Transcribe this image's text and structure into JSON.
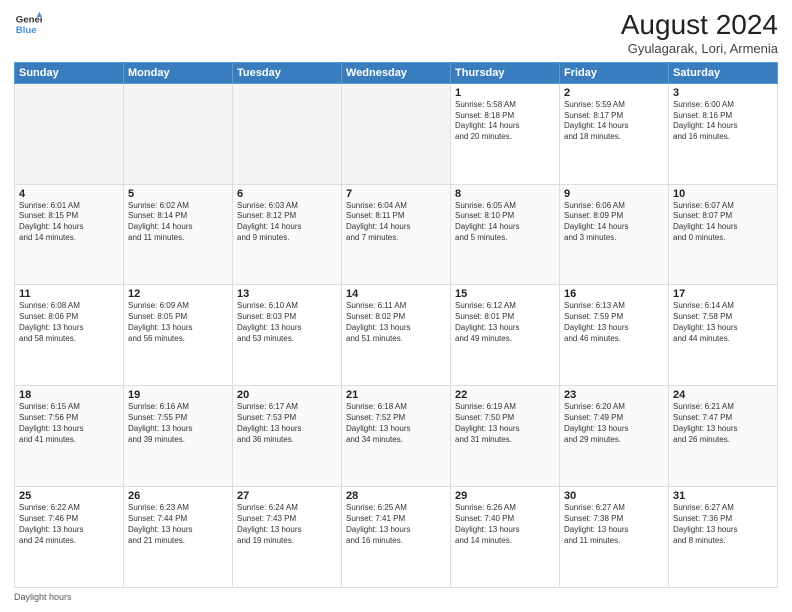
{
  "header": {
    "logo_line1": "General",
    "logo_line2": "Blue",
    "title": "August 2024",
    "subtitle": "Gyulagarak, Lori, Armenia"
  },
  "footer": {
    "daylight_label": "Daylight hours"
  },
  "weekdays": [
    "Sunday",
    "Monday",
    "Tuesday",
    "Wednesday",
    "Thursday",
    "Friday",
    "Saturday"
  ],
  "weeks": [
    [
      {
        "day": "",
        "info": ""
      },
      {
        "day": "",
        "info": ""
      },
      {
        "day": "",
        "info": ""
      },
      {
        "day": "",
        "info": ""
      },
      {
        "day": "1",
        "info": "Sunrise: 5:58 AM\nSunset: 8:18 PM\nDaylight: 14 hours\nand 20 minutes."
      },
      {
        "day": "2",
        "info": "Sunrise: 5:59 AM\nSunset: 8:17 PM\nDaylight: 14 hours\nand 18 minutes."
      },
      {
        "day": "3",
        "info": "Sunrise: 6:00 AM\nSunset: 8:16 PM\nDaylight: 14 hours\nand 16 minutes."
      }
    ],
    [
      {
        "day": "4",
        "info": "Sunrise: 6:01 AM\nSunset: 8:15 PM\nDaylight: 14 hours\nand 14 minutes."
      },
      {
        "day": "5",
        "info": "Sunrise: 6:02 AM\nSunset: 8:14 PM\nDaylight: 14 hours\nand 11 minutes."
      },
      {
        "day": "6",
        "info": "Sunrise: 6:03 AM\nSunset: 8:12 PM\nDaylight: 14 hours\nand 9 minutes."
      },
      {
        "day": "7",
        "info": "Sunrise: 6:04 AM\nSunset: 8:11 PM\nDaylight: 14 hours\nand 7 minutes."
      },
      {
        "day": "8",
        "info": "Sunrise: 6:05 AM\nSunset: 8:10 PM\nDaylight: 14 hours\nand 5 minutes."
      },
      {
        "day": "9",
        "info": "Sunrise: 6:06 AM\nSunset: 8:09 PM\nDaylight: 14 hours\nand 3 minutes."
      },
      {
        "day": "10",
        "info": "Sunrise: 6:07 AM\nSunset: 8:07 PM\nDaylight: 14 hours\nand 0 minutes."
      }
    ],
    [
      {
        "day": "11",
        "info": "Sunrise: 6:08 AM\nSunset: 8:06 PM\nDaylight: 13 hours\nand 58 minutes."
      },
      {
        "day": "12",
        "info": "Sunrise: 6:09 AM\nSunset: 8:05 PM\nDaylight: 13 hours\nand 56 minutes."
      },
      {
        "day": "13",
        "info": "Sunrise: 6:10 AM\nSunset: 8:03 PM\nDaylight: 13 hours\nand 53 minutes."
      },
      {
        "day": "14",
        "info": "Sunrise: 6:11 AM\nSunset: 8:02 PM\nDaylight: 13 hours\nand 51 minutes."
      },
      {
        "day": "15",
        "info": "Sunrise: 6:12 AM\nSunset: 8:01 PM\nDaylight: 13 hours\nand 49 minutes."
      },
      {
        "day": "16",
        "info": "Sunrise: 6:13 AM\nSunset: 7:59 PM\nDaylight: 13 hours\nand 46 minutes."
      },
      {
        "day": "17",
        "info": "Sunrise: 6:14 AM\nSunset: 7:58 PM\nDaylight: 13 hours\nand 44 minutes."
      }
    ],
    [
      {
        "day": "18",
        "info": "Sunrise: 6:15 AM\nSunset: 7:56 PM\nDaylight: 13 hours\nand 41 minutes."
      },
      {
        "day": "19",
        "info": "Sunrise: 6:16 AM\nSunset: 7:55 PM\nDaylight: 13 hours\nand 39 minutes."
      },
      {
        "day": "20",
        "info": "Sunrise: 6:17 AM\nSunset: 7:53 PM\nDaylight: 13 hours\nand 36 minutes."
      },
      {
        "day": "21",
        "info": "Sunrise: 6:18 AM\nSunset: 7:52 PM\nDaylight: 13 hours\nand 34 minutes."
      },
      {
        "day": "22",
        "info": "Sunrise: 6:19 AM\nSunset: 7:50 PM\nDaylight: 13 hours\nand 31 minutes."
      },
      {
        "day": "23",
        "info": "Sunrise: 6:20 AM\nSunset: 7:49 PM\nDaylight: 13 hours\nand 29 minutes."
      },
      {
        "day": "24",
        "info": "Sunrise: 6:21 AM\nSunset: 7:47 PM\nDaylight: 13 hours\nand 26 minutes."
      }
    ],
    [
      {
        "day": "25",
        "info": "Sunrise: 6:22 AM\nSunset: 7:46 PM\nDaylight: 13 hours\nand 24 minutes."
      },
      {
        "day": "26",
        "info": "Sunrise: 6:23 AM\nSunset: 7:44 PM\nDaylight: 13 hours\nand 21 minutes."
      },
      {
        "day": "27",
        "info": "Sunrise: 6:24 AM\nSunset: 7:43 PM\nDaylight: 13 hours\nand 19 minutes."
      },
      {
        "day": "28",
        "info": "Sunrise: 6:25 AM\nSunset: 7:41 PM\nDaylight: 13 hours\nand 16 minutes."
      },
      {
        "day": "29",
        "info": "Sunrise: 6:26 AM\nSunset: 7:40 PM\nDaylight: 13 hours\nand 14 minutes."
      },
      {
        "day": "30",
        "info": "Sunrise: 6:27 AM\nSunset: 7:38 PM\nDaylight: 13 hours\nand 11 minutes."
      },
      {
        "day": "31",
        "info": "Sunrise: 6:27 AM\nSunset: 7:36 PM\nDaylight: 13 hours\nand 8 minutes."
      }
    ]
  ]
}
